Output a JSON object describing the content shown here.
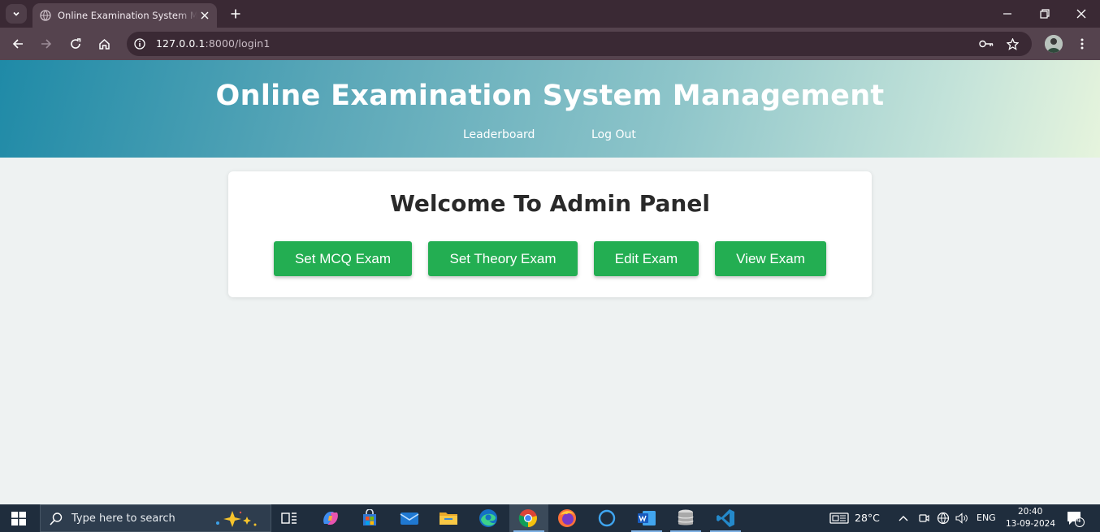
{
  "browser": {
    "tab_title": "Online Examination System Management",
    "url_host": "127.0.0.1",
    "url_path": ":8000/login1",
    "icons": [
      "tab-list-icon",
      "globe-icon",
      "close-icon",
      "plus-icon",
      "minimize-icon",
      "restore-icon",
      "back-icon",
      "forward-icon",
      "reload-icon",
      "home-icon",
      "site-info-icon",
      "password-key-icon",
      "bookmark-star-icon",
      "profile-avatar",
      "menu-icon"
    ]
  },
  "header": {
    "title": "Online Examination System Management",
    "nav": [
      {
        "label": "Leaderboard"
      },
      {
        "label": "Log Out"
      }
    ]
  },
  "panel": {
    "title": "Welcome To Admin Panel",
    "buttons": [
      {
        "label": "Set MCQ Exam"
      },
      {
        "label": "Set Theory Exam"
      },
      {
        "label": "Edit Exam"
      },
      {
        "label": "View Exam"
      }
    ]
  },
  "taskbar": {
    "search_placeholder": "Type here to search",
    "apps": [
      "task-view-icon",
      "copilot-icon",
      "store-icon",
      "mail-icon",
      "file-explorer-icon",
      "edge-icon",
      "chrome-icon",
      "firefox-icon",
      "cortana-icon",
      "word-icon",
      "database-icon",
      "vscode-icon"
    ],
    "active_app": "chrome-icon",
    "weather": "28°C",
    "language": "ENG",
    "time": "20:40",
    "date": "13-09-2024",
    "notification_count": "4"
  },
  "colors": {
    "button_green": "#23ae52",
    "header_gradient_start": "#1f8aa7",
    "header_gradient_end": "#e6f4dd",
    "page_background": "#eef2f2",
    "chrome_frame": "#3a2934",
    "chrome_toolbar": "#55434e",
    "taskbar": "#1f2d3d"
  }
}
